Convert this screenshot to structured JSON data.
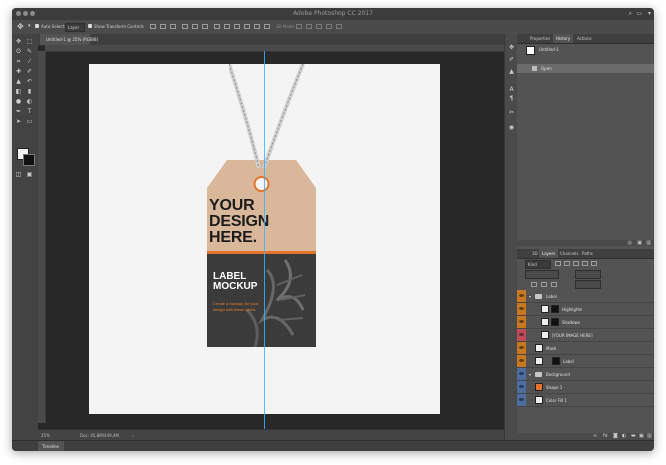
{
  "app": {
    "title": "Adobe Photoshop CC 2017"
  },
  "options_bar": {
    "auto_select_label": "Auto-Select:",
    "auto_select_value": "Layer",
    "show_transform_label": "Show Transform Controls",
    "mode_3d_label": "3D Mode:"
  },
  "document": {
    "tab_title": "Untitled-1 @ 25% (RGB/8)",
    "zoom": "25%",
    "doc_info": "Doc: 45,8M/449,4M"
  },
  "canvas": {
    "tag_line1": "YOUR",
    "tag_line2": "DESIGN",
    "tag_line3": "HERE.",
    "label_line1": "LABEL",
    "label_line2": "MOCKUP",
    "small_text_1": "Create a mockup for your",
    "small_text_2": "design with these labels"
  },
  "timeline": {
    "label": "Timeline"
  },
  "panels": {
    "top_tabs": [
      "Properties",
      "History",
      "Actions"
    ],
    "history": [
      "Untitled-1",
      "Open"
    ],
    "layer_tabs": [
      "3D",
      "Layers",
      "Channels",
      "Paths"
    ],
    "kind_label": "Kind",
    "layers": [
      {
        "name": "Label",
        "type": "group",
        "color": "#c8781f"
      },
      {
        "name": "Highlights",
        "type": "layer",
        "color": "#c8781f"
      },
      {
        "name": "Shadows",
        "type": "layer",
        "color": "#c8781f"
      },
      {
        "name": "[YOUR IMAGE HERE]",
        "type": "layer",
        "color": "#c0495a"
      },
      {
        "name": "Mask",
        "type": "layer",
        "color": "#c8781f"
      },
      {
        "name": "Label",
        "type": "layer",
        "color": "#c8781f"
      },
      {
        "name": "Background",
        "type": "group",
        "color": "#4d6c9f"
      },
      {
        "name": "Shape 1",
        "type": "layer",
        "color": "#4d6c9f"
      },
      {
        "name": "Color Fill 1",
        "type": "layer",
        "color": "#4d6c9f"
      }
    ]
  },
  "colors": {
    "guide": "#3ab3ff",
    "tag_kraft": "#d8b79b",
    "tag_dark": "#3b3b3b",
    "tag_stripe": "#e5742a",
    "accent_text": "#e8812b"
  }
}
